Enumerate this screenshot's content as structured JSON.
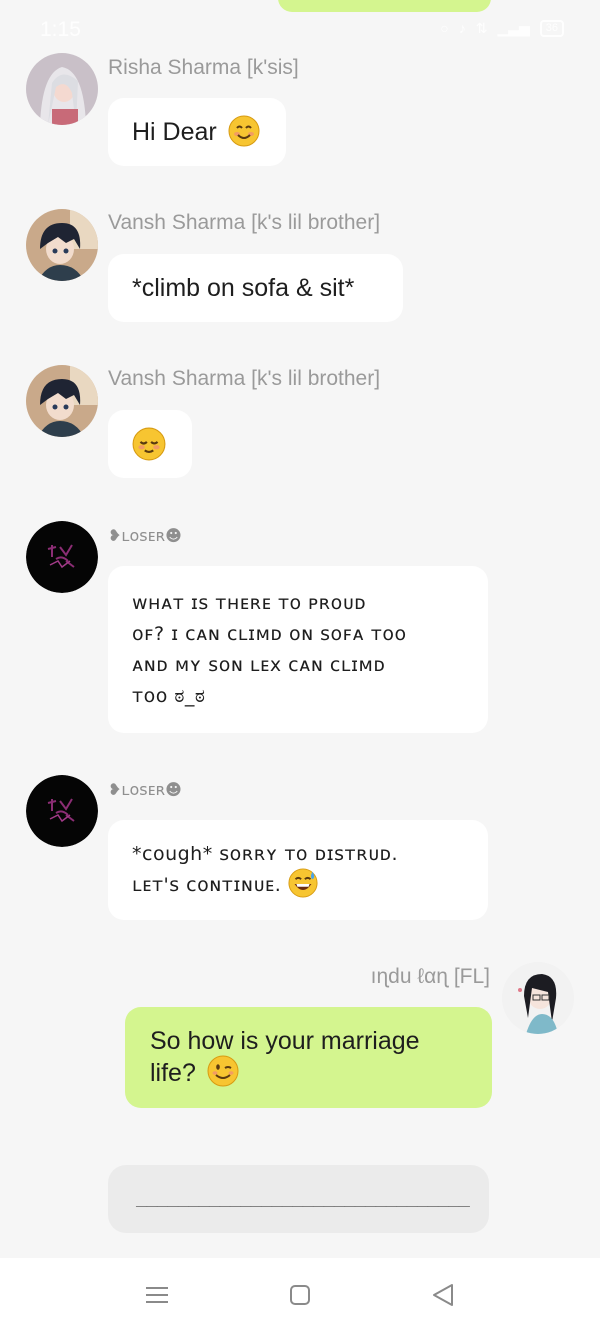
{
  "status_bar": {
    "time": "1:15",
    "icons": [
      "alarm-icon",
      "silent-icon",
      "data-icon",
      "signal-icon",
      "battery-icon"
    ],
    "battery": "36"
  },
  "messages": [
    {
      "sender": "Risha Sharma [k'sis]",
      "text": "Hi Dear",
      "emoji": "smiling-face-icon",
      "avatar": "girl-avatar"
    },
    {
      "sender": "Vansh Sharma [k's lil brother]",
      "text": "*climb on sofa & sit*",
      "avatar": "boy-avatar"
    },
    {
      "sender": "Vansh Sharma [k's lil brother]",
      "text": "",
      "emoji": "relieved-face-icon",
      "avatar": "boy-avatar"
    },
    {
      "sender": "❥ʟᴏꜱᴇʀ☻",
      "lines": [
        "ᴡʜᴀᴛ ɪꜱ ᴛʜᴇʀᴇ ᴛᴏ ᴘʀᴏᴜᴅ",
        "ᴏꜰ? ɪ ᴄᴀɴ ᴄʟɪᴍᴅ ᴏɴ ꜱᴏꜰᴀ ᴛᴏᴏ",
        "ᴀɴᴅ ᴍʏ ꜱᴏɴ ʟᴇx ᴄᴀɴ ᴄʟɪᴍᴅ",
        "ᴛᴏᴏ ಠ_ಠ"
      ],
      "avatar": "dark-avatar"
    },
    {
      "sender": "❥ʟᴏꜱᴇʀ☻",
      "lines": [
        "*cough* ꜱᴏʀʀʏ ᴛᴏ ᴅɪꜱᴛʀᴜᴅ.",
        "ʟᴇᴛ'ꜱ ᴄᴏɴᴛɪɴᴜᴇ."
      ],
      "emoji": "grinning-sweat-icon",
      "avatar": "dark-avatar"
    },
    {
      "sender": "ıɳdu ℓαɳ [FL]",
      "lines": [
        "So how is your marriage",
        "life?"
      ],
      "emoji": "winking-face-icon",
      "avatar": "anime-girl-avatar",
      "mine": true
    }
  ],
  "composer": {
    "value": "________________________________"
  },
  "nav": {
    "icons": [
      "menu-icon",
      "home-icon",
      "back-icon"
    ]
  },
  "colors": {
    "background": "#f6f6f6",
    "bubble_other": "#ffffff",
    "bubble_mine": "#d4f58f",
    "sender_text": "#9a9a9a"
  }
}
